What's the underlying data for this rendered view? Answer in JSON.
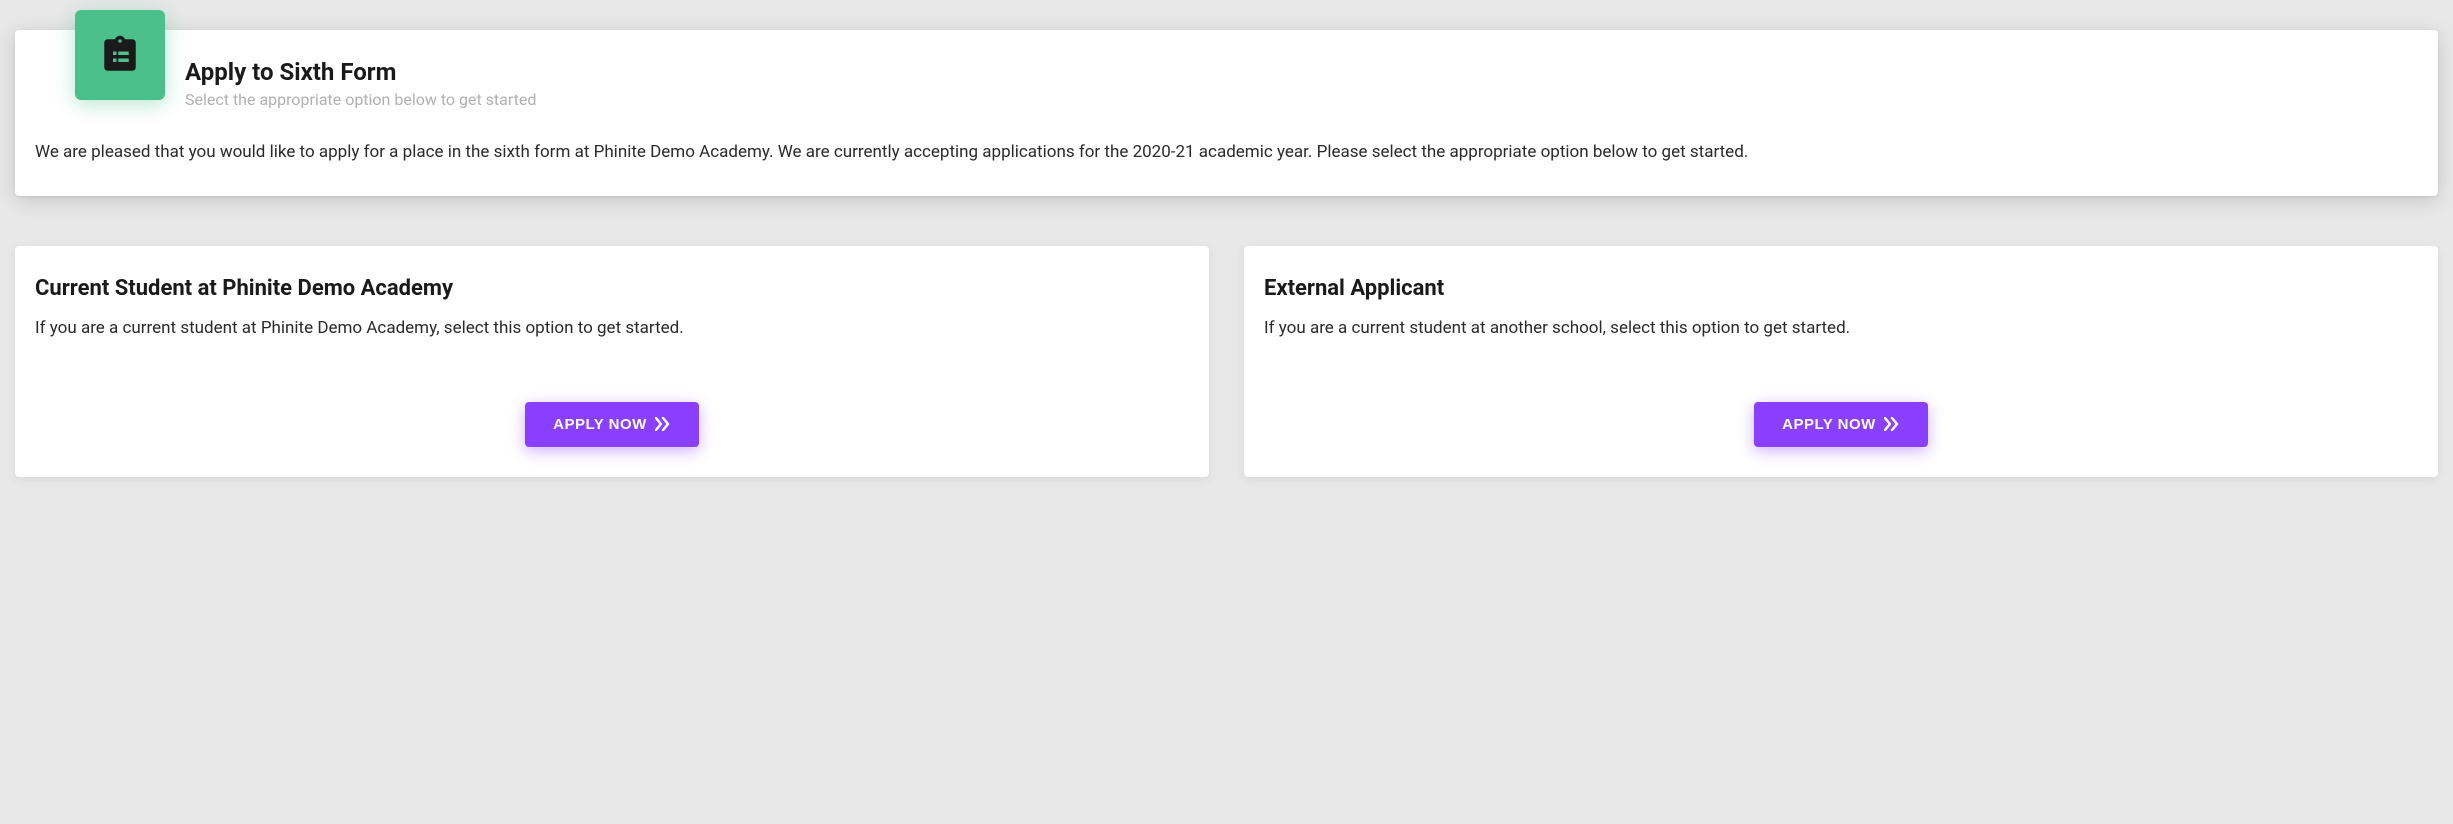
{
  "header": {
    "title": "Apply to Sixth Form",
    "subtitle": "Select the appropriate option below to get started",
    "description": "We are pleased that you would like to apply for a place in the sixth form at Phinite Demo Academy. We are currently accepting applications for the 2020-21 academic year. Please select the appropriate option below to get started."
  },
  "options": {
    "current_student": {
      "title": "Current Student at Phinite Demo Academy",
      "description": "If you are a current student at Phinite Demo Academy, select this option to get started.",
      "button_label": "APPLY NOW"
    },
    "external_applicant": {
      "title": "External Applicant",
      "description": "If you are a current student at another school, select this option to get started.",
      "button_label": "APPLY NOW"
    }
  }
}
